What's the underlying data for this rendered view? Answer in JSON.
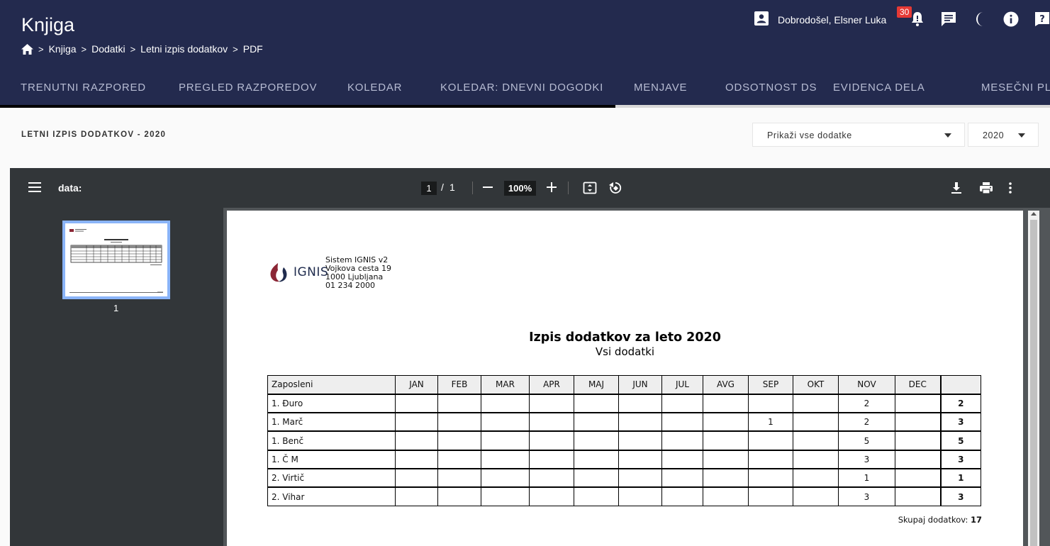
{
  "header": {
    "title": "Knjiga",
    "breadcrumb": [
      "Knjiga",
      "Dodatki",
      "Letni izpis dodatkov",
      "PDF"
    ],
    "greeting": "Dobrodošel, Elsner Luka",
    "notification_count": "30"
  },
  "tabs": [
    {
      "label": "TRENUTNI RAZPORED",
      "active": true
    },
    {
      "label": "PREGLED RAZPOREDOV"
    },
    {
      "label": "KOLEDAR"
    },
    {
      "label": "KOLEDAR: DNEVNI DOGODKI"
    },
    {
      "label": "MENJAVE"
    },
    {
      "label": "ODSOTNOST DS"
    },
    {
      "label": "EVIDENCA DELA"
    },
    {
      "label": "MESEČNI PLA"
    }
  ],
  "subheader": {
    "title": "LETNI IZPIS DODATKOV - 2020",
    "filter_select": "Prikaži vse dodatke",
    "year_select": "2020"
  },
  "viewer": {
    "file_title": "data:",
    "current_page": "1",
    "page_separator": "/",
    "total_pages": "1",
    "zoom": "100%",
    "thumbnail_label": "1"
  },
  "document": {
    "logo_text": "IGNIS",
    "company_lines": [
      "Sistem IGNIS v2",
      "Vojkova cesta 19",
      "1000 Ljubljana",
      "01 234 2000"
    ],
    "title": "Izpis dodatkov za leto 2020",
    "subtitle": "Vsi dodatki",
    "columns": [
      "Zaposleni",
      "JAN",
      "FEB",
      "MAR",
      "APR",
      "MAJ",
      "JUN",
      "JUL",
      "AVG",
      "SEP",
      "OKT",
      "NOV",
      "DEC",
      ""
    ],
    "rows": [
      {
        "name": "1. Đuro",
        "cells": [
          "",
          "",
          "",
          "",
          "",
          "",
          "",
          "",
          "",
          "",
          "2",
          ""
        ],
        "total": "2"
      },
      {
        "name": "1. Marč",
        "cells": [
          "",
          "",
          "",
          "",
          "",
          "",
          "",
          "",
          "1",
          "",
          "2",
          ""
        ],
        "total": "3"
      },
      {
        "name": "1. Benč",
        "cells": [
          "",
          "",
          "",
          "",
          "",
          "",
          "",
          "",
          "",
          "",
          "5",
          ""
        ],
        "total": "5"
      },
      {
        "name": "1. Č M",
        "cells": [
          "",
          "",
          "",
          "",
          "",
          "",
          "",
          "",
          "",
          "",
          "3",
          ""
        ],
        "total": "3"
      },
      {
        "name": "2. Virtič",
        "cells": [
          "",
          "",
          "",
          "",
          "",
          "",
          "",
          "",
          "",
          "",
          "1",
          ""
        ],
        "total": "1"
      },
      {
        "name": "2. Vihar",
        "cells": [
          "",
          "",
          "",
          "",
          "",
          "",
          "",
          "",
          "",
          "",
          "3",
          ""
        ],
        "total": "3"
      }
    ],
    "grand_total_label": "Skupaj dodatkov:",
    "grand_total_value": "17"
  },
  "colors": {
    "header_bg": "#232a4e",
    "toolbar_bg": "#323639",
    "viewer_bg": "#525659",
    "badge": "#e53935",
    "thumb_border": "#8ab4f8",
    "logo_red": "#8b2635",
    "logo_navy": "#1f2b4d"
  }
}
